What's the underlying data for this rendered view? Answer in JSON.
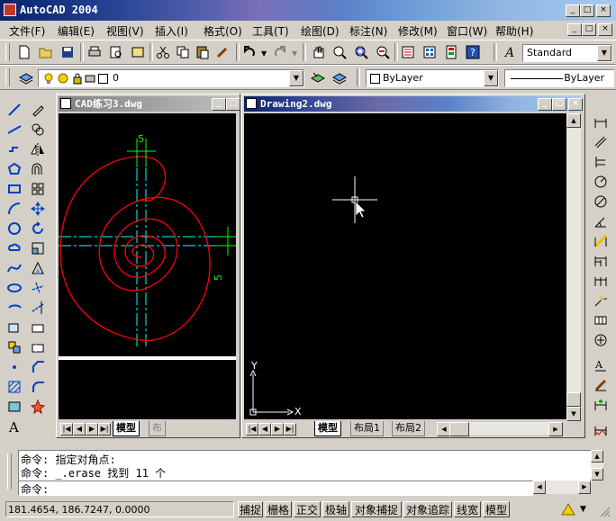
{
  "app": {
    "title": "AutoCAD 2004"
  },
  "menu": [
    "文件(F)",
    "编辑(E)",
    "视图(V)",
    "插入(I)",
    "格式(O)",
    "工具(T)",
    "绘图(D)",
    "标注(N)",
    "修改(M)",
    "窗口(W)",
    "帮助(H)"
  ],
  "toolbar": {
    "text_style": "Standard",
    "layer": "0",
    "color": "ByLayer",
    "linetype": "ByLayer"
  },
  "doc1": {
    "title": "CAD练习3.dwg",
    "tabs": [
      "模型",
      "布"
    ],
    "dim_top": "5",
    "dim_right": "5"
  },
  "doc2": {
    "title": "Drawing2.dwg",
    "tabs": [
      "模型",
      "布局1",
      "布局2"
    ],
    "ucs_x": "X",
    "ucs_y": "Y"
  },
  "command": {
    "line1": "命令: 指定对角点:",
    "line2": "命令: _.erase 找到 11 个",
    "prompt": "命令:"
  },
  "status": {
    "coords": "181.4654, 186.7247, 0.0000",
    "buttons": [
      "捕捉",
      "栅格",
      "正交",
      "极轴",
      "对象捕捉",
      "对象追踪",
      "线宽",
      "模型"
    ]
  },
  "colors": {
    "drawing_red": "#ff0000",
    "centerline_cyan": "#00ffff",
    "dim_green": "#00ff00"
  }
}
